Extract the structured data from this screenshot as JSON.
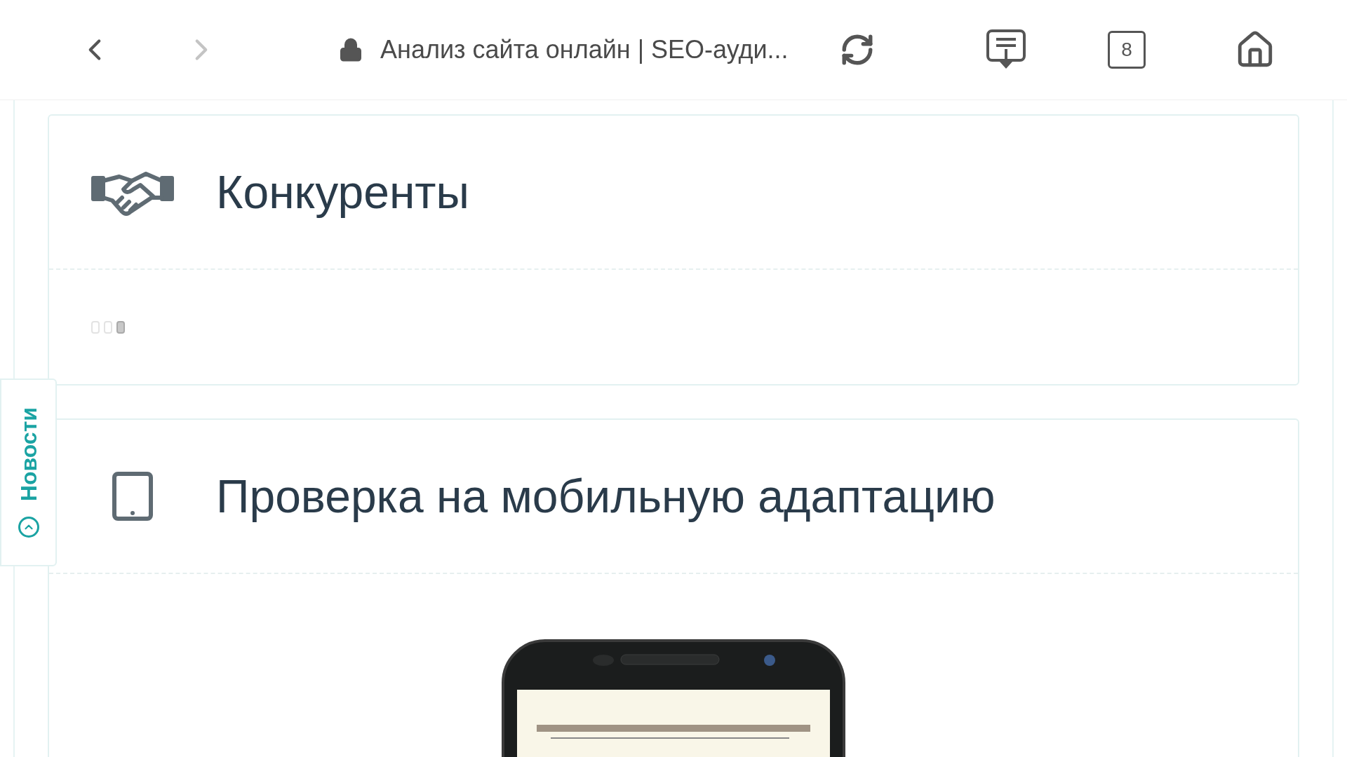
{
  "browser": {
    "title": "Анализ сайта онлайн | SEO-ауди...",
    "tab_count": "8"
  },
  "cards": [
    {
      "kind": "handshake",
      "title": "Конкуренты",
      "content": {
        "kind": "loader"
      }
    },
    {
      "kind": "tablet",
      "title": "Проверка на мобильную адаптацию"
    }
  ],
  "side_tab": {
    "label": "Новости"
  }
}
